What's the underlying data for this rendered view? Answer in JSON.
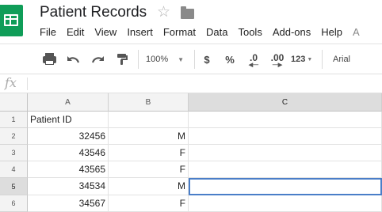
{
  "app": {
    "document_title": "Patient Records"
  },
  "menu": [
    {
      "id": "file",
      "label": "File"
    },
    {
      "id": "edit",
      "label": "Edit"
    },
    {
      "id": "view",
      "label": "View"
    },
    {
      "id": "insert",
      "label": "Insert"
    },
    {
      "id": "format",
      "label": "Format"
    },
    {
      "id": "data",
      "label": "Data"
    },
    {
      "id": "tools",
      "label": "Tools"
    },
    {
      "id": "addons",
      "label": "Add-ons"
    },
    {
      "id": "help",
      "label": "Help"
    },
    {
      "id": "accessibility",
      "label": "A"
    }
  ],
  "toolbar": {
    "zoom": "100%",
    "currency": "$",
    "percent": "%",
    "decrease_decimal": ".0",
    "increase_decimal": ".00",
    "more_formats": "123",
    "font": "Arial"
  },
  "formula_bar": {
    "fx_label": "fx",
    "value": ""
  },
  "sheet": {
    "columns": [
      {
        "letter": "A",
        "selected": false
      },
      {
        "letter": "B",
        "selected": false
      },
      {
        "letter": "C",
        "selected": true
      }
    ],
    "rows": [
      {
        "number": "1",
        "selected": false,
        "a": "Patient ID",
        "b": "",
        "c": ""
      },
      {
        "number": "2",
        "selected": false,
        "a": "32456",
        "b": "M",
        "c": ""
      },
      {
        "number": "3",
        "selected": false,
        "a": "43546",
        "b": "F",
        "c": ""
      },
      {
        "number": "4",
        "selected": false,
        "a": "43565",
        "b": "F",
        "c": ""
      },
      {
        "number": "5",
        "selected": true,
        "a": "34534",
        "b": "M",
        "c": ""
      },
      {
        "number": "6",
        "selected": false,
        "a": "34567",
        "b": "F",
        "c": ""
      }
    ],
    "active_cell": "C5"
  },
  "colors": {
    "brand": "#0f9d58",
    "selection": "#4a7ec8",
    "header_bg": "#f3f3f3",
    "header_active_bg": "#dddddd"
  }
}
